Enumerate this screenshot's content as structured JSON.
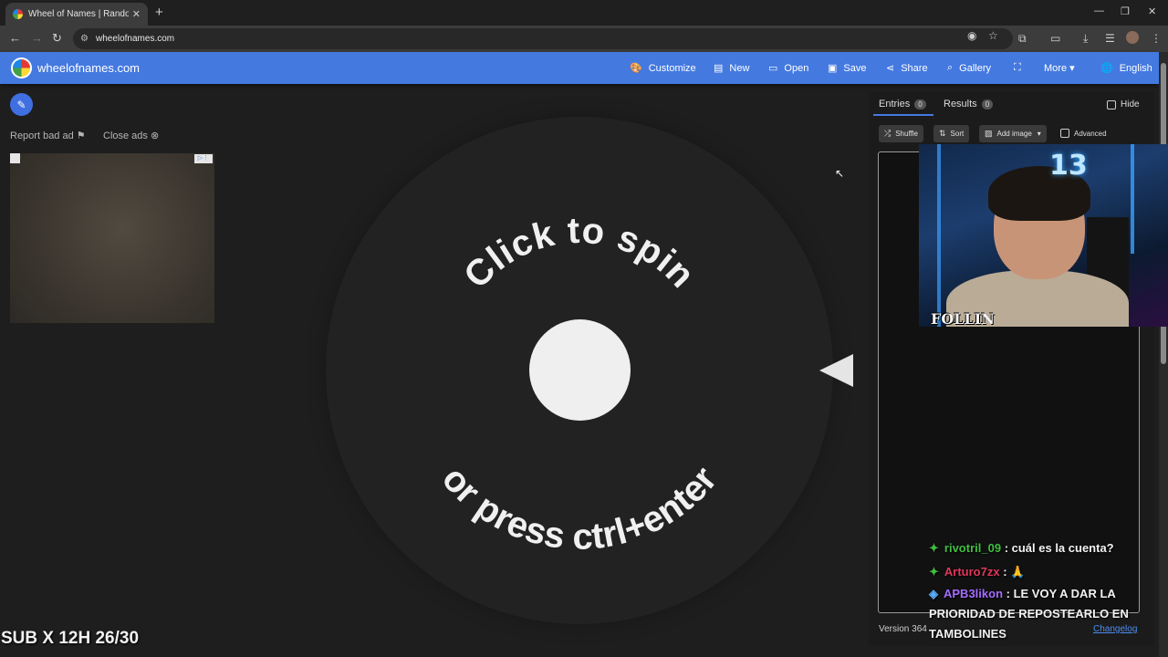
{
  "browser": {
    "tab_title": "Wheel of Names | Random nam",
    "tab_close": "✕",
    "new_tab": "+",
    "url": "wheelofnames.com",
    "window_controls": [
      "—",
      "❐",
      "✕"
    ]
  },
  "site": {
    "name": "wheelofnames.com",
    "menu": [
      {
        "icon": "🎨",
        "label": "Customize"
      },
      {
        "icon": "▤",
        "label": "New"
      },
      {
        "icon": "▭",
        "label": "Open"
      },
      {
        "icon": "▣",
        "label": "Save"
      },
      {
        "icon": "⋖",
        "label": "Share"
      },
      {
        "icon": "⌕",
        "label": "Gallery"
      },
      {
        "icon": "⛶",
        "label": ""
      },
      {
        "icon": "",
        "label": "More ▾"
      },
      {
        "icon": "🌐",
        "label": "English"
      }
    ],
    "accent_color": "#4479e0"
  },
  "ads": {
    "report_label": "Report bad ad",
    "close_label": "Close ads"
  },
  "wheel": {
    "top_text": "Click to spin",
    "bottom_text": "or press ctrl+enter"
  },
  "panel": {
    "tabs": [
      {
        "label": "Entries",
        "count": "0"
      },
      {
        "label": "Results",
        "count": "0"
      }
    ],
    "hide_label": "Hide",
    "buttons": {
      "shuffle": "Shuffle",
      "sort": "Sort",
      "add_image": "Add image"
    },
    "advanced_label": "Advanced",
    "version": "Version 364",
    "changelog": "Changelog"
  },
  "stream": {
    "cam_sign": "13",
    "cam_logo": "FOLLIN",
    "chat": [
      {
        "user": "rivotril_09",
        "message": ": cuál es la cuenta?"
      },
      {
        "user": "Arturo7zx",
        "message": ":"
      },
      {
        "user": "APB3likon",
        "message": ": LE VOY A DAR LA PRIORIDAD DE REPOSTEARLO EN TAMBOLINES"
      }
    ],
    "sub_overlay": "SUB X 12H 26/30"
  }
}
